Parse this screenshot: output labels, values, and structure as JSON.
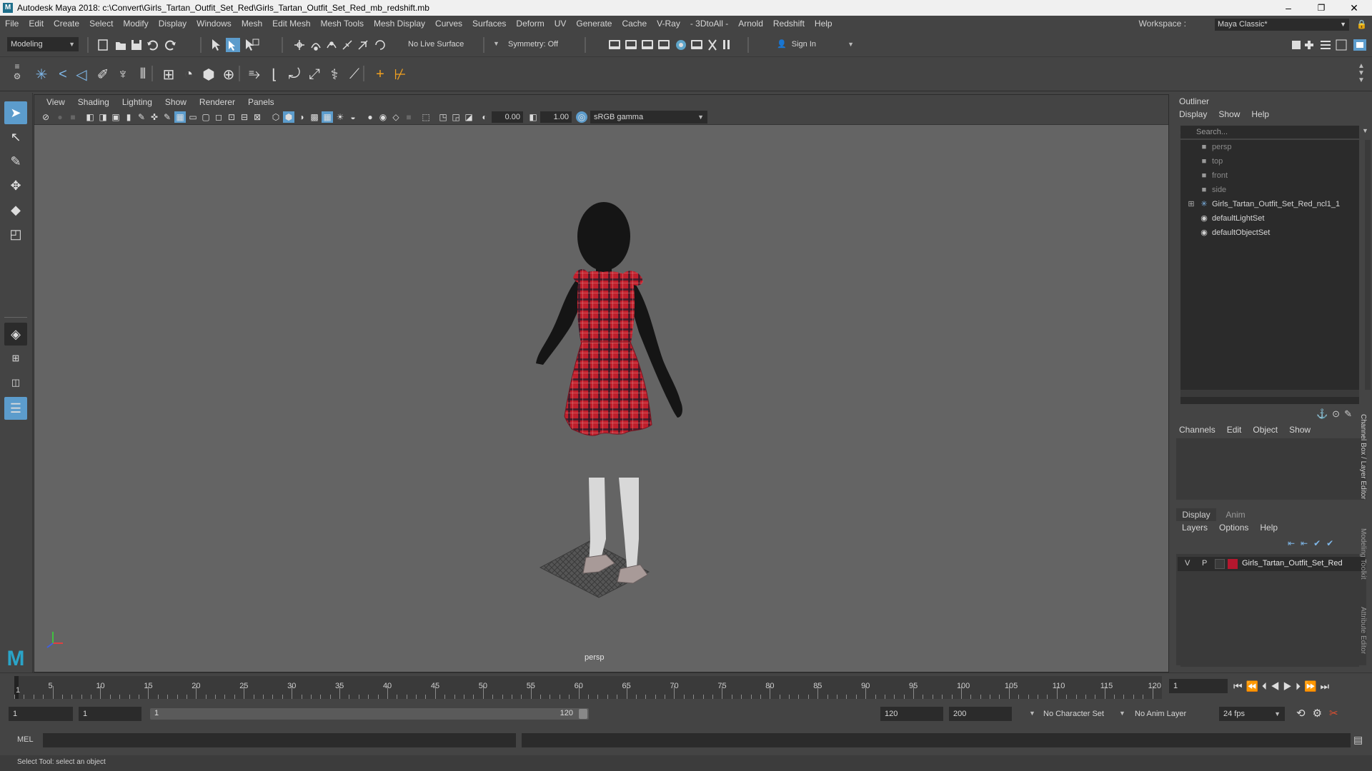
{
  "window": {
    "title": "Autodesk Maya 2018: c:\\Convert\\Girls_Tartan_Outfit_Set_Red\\Girls_Tartan_Outfit_Set_Red_mb_redshift.mb",
    "minimize": "–",
    "maximize": "❐",
    "close": "✕"
  },
  "menubar": {
    "items": [
      "File",
      "Edit",
      "Create",
      "Select",
      "Modify",
      "Display",
      "Windows",
      "Mesh",
      "Edit Mesh",
      "Mesh Tools",
      "Mesh Display",
      "Curves",
      "Surfaces",
      "Deform",
      "UV",
      "Generate",
      "Cache",
      "V-Ray",
      "- 3DtoAll -",
      "Arnold",
      "Redshift",
      "Help"
    ],
    "workspace_label": "Workspace :",
    "workspace_value": "Maya Classic*"
  },
  "statusline": {
    "mode": "Modeling",
    "live_surface": "No Live Surface",
    "symmetry": "Symmetry: Off",
    "sign_in": "Sign In"
  },
  "viewport": {
    "menu": [
      "View",
      "Shading",
      "Lighting",
      "Show",
      "Renderer",
      "Panels"
    ],
    "exposure": "0.00",
    "gamma": "1.00",
    "color_space": "sRGB gamma",
    "camera_label": "persp"
  },
  "outliner": {
    "title": "Outliner",
    "menu": [
      "Display",
      "Show",
      "Help"
    ],
    "search_placeholder": "Search...",
    "items": [
      {
        "label": "persp",
        "icon": "camera-icon",
        "dim": true
      },
      {
        "label": "top",
        "icon": "camera-icon",
        "dim": true
      },
      {
        "label": "front",
        "icon": "camera-icon",
        "dim": true
      },
      {
        "label": "side",
        "icon": "camera-icon",
        "dim": true
      },
      {
        "label": "Girls_Tartan_Outfit_Set_Red_ncl1_1",
        "icon": "joint-icon",
        "dim": false
      },
      {
        "label": "defaultLightSet",
        "icon": "set-icon",
        "dim": false
      },
      {
        "label": "defaultObjectSet",
        "icon": "set-icon",
        "dim": false
      }
    ]
  },
  "channelbox": {
    "menu": [
      "Channels",
      "Edit",
      "Object",
      "Show"
    ]
  },
  "layereditor": {
    "tabs": [
      "Display",
      "Anim"
    ],
    "menu": [
      "Layers",
      "Options",
      "Help"
    ],
    "layer": {
      "v": "V",
      "p": "P",
      "name": "Girls_Tartan_Outfit_Set_Red",
      "color": "#b5172e"
    }
  },
  "side_tabs": [
    "Channel Box / Layer Editor",
    "Modeling Toolkit",
    "Attribute Editor"
  ],
  "timeline": {
    "ticks": [
      "1",
      "5",
      "10",
      "15",
      "20",
      "25",
      "30",
      "35",
      "40",
      "45",
      "50",
      "55",
      "60",
      "65",
      "70",
      "75",
      "80",
      "85",
      "90",
      "95",
      "100",
      "105",
      "110",
      "115",
      "120"
    ],
    "current_frame": "1"
  },
  "range": {
    "start": "1",
    "playback_start": "1",
    "slider_start": "1",
    "slider_end": "120",
    "playback_end": "120",
    "end": "200",
    "character_set": "No Character Set",
    "anim_layer": "No Anim Layer",
    "fps": "24 fps"
  },
  "cmdline": {
    "label": "MEL"
  },
  "helpline": {
    "text": "Select Tool: select an object"
  }
}
